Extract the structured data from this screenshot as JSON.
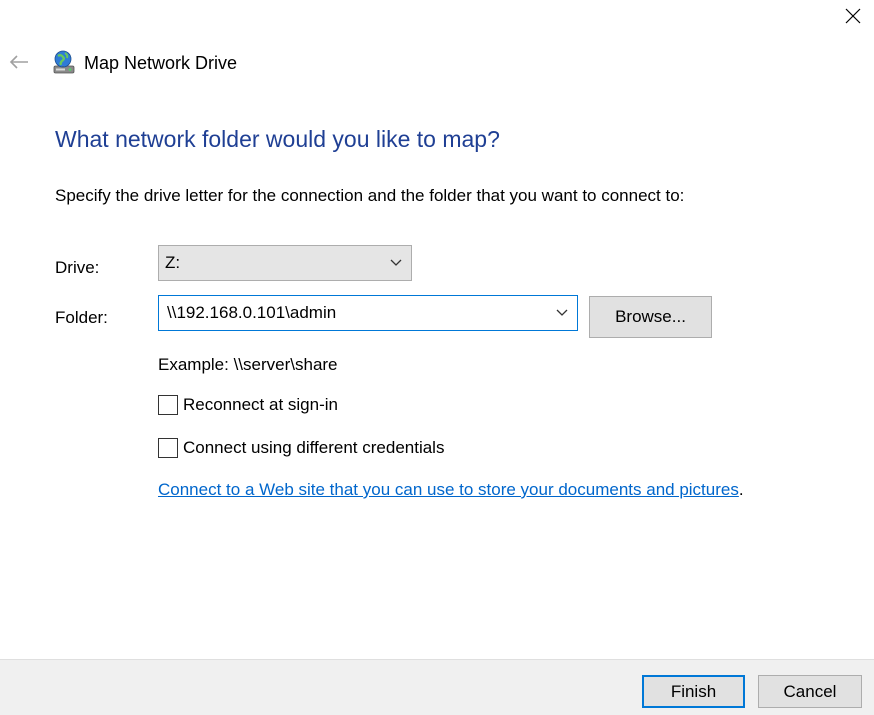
{
  "window": {
    "title": "Map Network Drive",
    "close_icon": "close-icon",
    "back_icon": "back-arrow-icon",
    "app_icon": "network-drive-icon"
  },
  "main": {
    "heading": "What network folder would you like to map?",
    "instructions": "Specify the drive letter for the connection and the folder that you want to connect to:"
  },
  "drive": {
    "label": "Drive:",
    "value": "Z:"
  },
  "folder": {
    "label": "Folder:",
    "value": "\\\\192.168.0.101\\admin",
    "browse_label": "Browse...",
    "example": "Example: \\\\server\\share"
  },
  "options": {
    "reconnect_label": "Reconnect at sign-in",
    "reconnect_checked": false,
    "credentials_label": "Connect using different credentials",
    "credentials_checked": false
  },
  "web_link": {
    "text": "Connect to a Web site that you can use to store your documents and pictures",
    "suffix": "."
  },
  "footer": {
    "finish_label": "Finish",
    "cancel_label": "Cancel"
  },
  "colors": {
    "heading": "#1f3f94",
    "link": "#0066cc",
    "focus_accent": "#0078d7",
    "footer_bg": "#f0f0f0"
  }
}
